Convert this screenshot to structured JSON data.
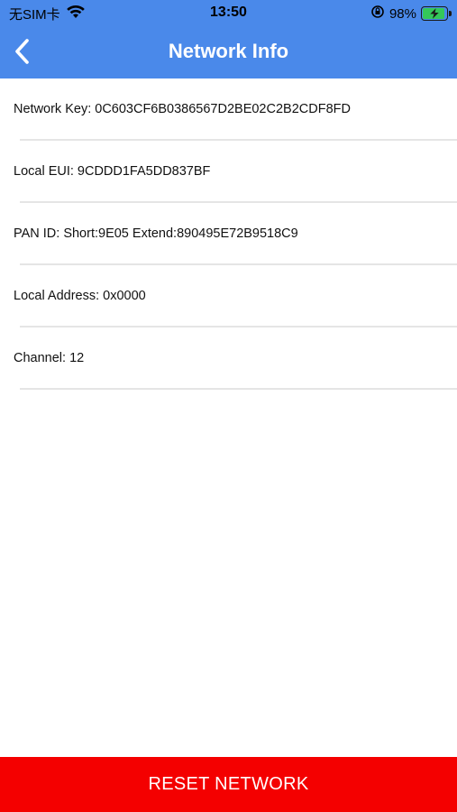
{
  "status_bar": {
    "carrier": "无SIM卡",
    "wifi_icon": "wifi-icon",
    "time": "13:50",
    "orientation_lock_icon": "orientation-lock-icon",
    "battery_percent": "98%",
    "battery_level": 0.98,
    "charging": true
  },
  "nav": {
    "back_icon": "chevron-left-icon",
    "title": "Network Info"
  },
  "info_items": [
    {
      "text": "Network Key: 0C603CF6B0386567D2BE02C2B2CDF8FD"
    },
    {
      "text": "Local EUI: 9CDDD1FA5DD837BF"
    },
    {
      "text": "PAN ID: Short:9E05 Extend:890495E72B9518C9"
    },
    {
      "text": "Local Address: 0x0000"
    },
    {
      "text": "Channel: 12"
    }
  ],
  "footer": {
    "reset_label": "RESET NETWORK"
  },
  "colors": {
    "header": "#4a89ea",
    "reset_button": "#f40000",
    "battery_fill": "#34c759"
  }
}
